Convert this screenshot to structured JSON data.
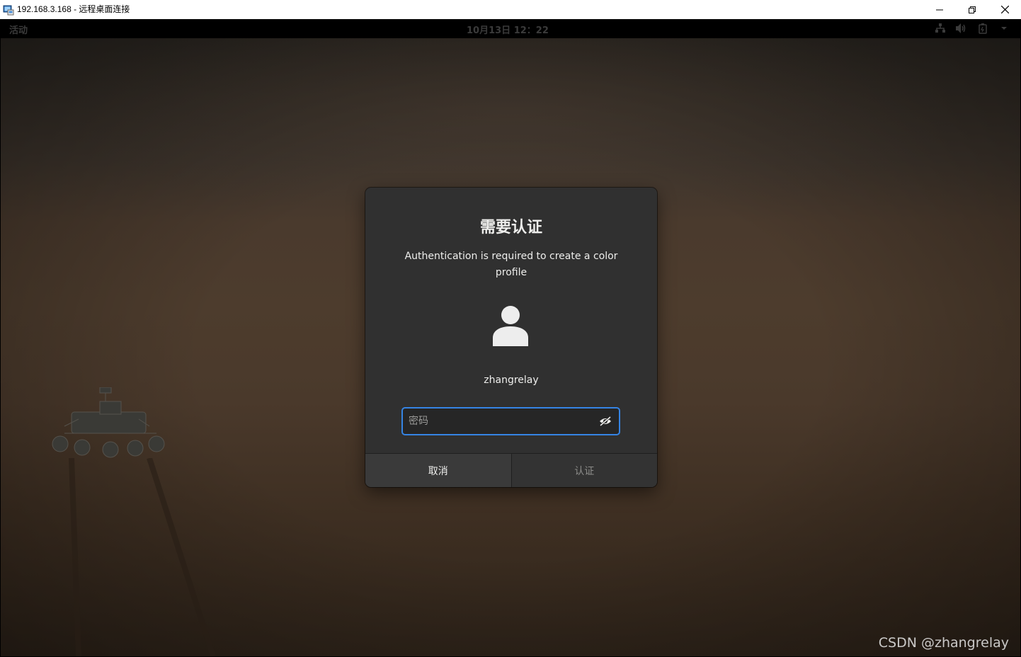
{
  "window": {
    "title": "192.168.3.168 - 远程桌面连接",
    "app_icon": "remote-desktop-icon",
    "controls": [
      "minimize-icon",
      "restore-icon",
      "close-icon"
    ]
  },
  "gnome_topbar": {
    "activities": "活动",
    "clock": "10月13日 12：22",
    "tray_icons": [
      "network-icon",
      "volume-icon",
      "battery-icon",
      "chevron-down-icon"
    ]
  },
  "dialog": {
    "title": "需要认证",
    "message": "Authentication is required to create a color profile",
    "username": "zhangrelay",
    "password": {
      "placeholder": "密码",
      "value": ""
    },
    "buttons": {
      "cancel": "取消",
      "authenticate": "认证"
    },
    "accent_color": "#3584e4"
  },
  "watermark": "CSDN @zhangrelay"
}
